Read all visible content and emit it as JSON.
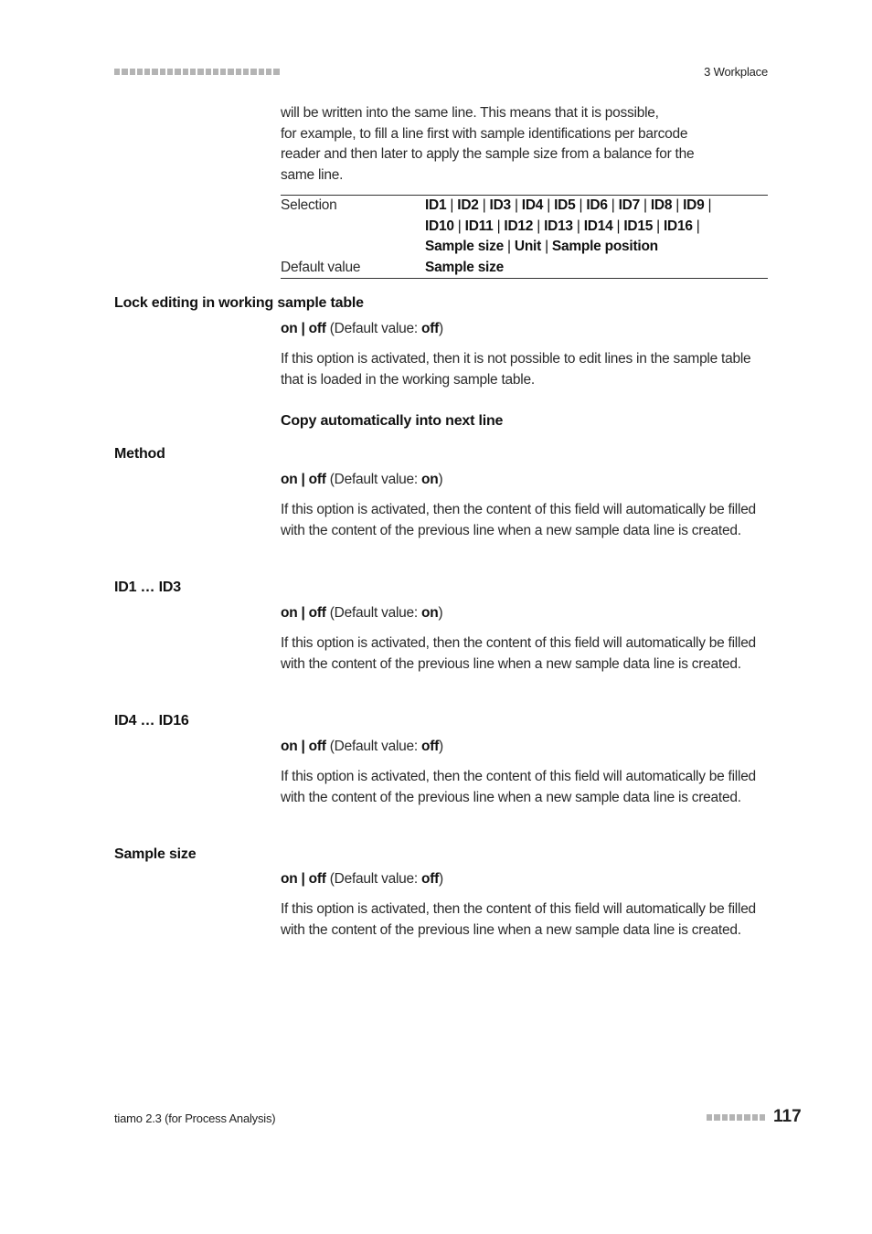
{
  "header": {
    "chapter": "3 Workplace",
    "decor_squares": 22
  },
  "intro": {
    "lines": [
      "will be written into the same line. This means that it is possible,",
      "for example, to fill a line first with sample identifications per barcode",
      "reader and then later to apply the sample size from a balance for the",
      "same line."
    ]
  },
  "table": {
    "selection_label": "Selection",
    "selection_lines": [
      [
        "ID1",
        "ID2",
        "ID3",
        "ID4",
        "ID5",
        "ID6",
        "ID7",
        "ID8",
        "ID9",
        ""
      ],
      [
        "ID10",
        "ID11",
        "ID12",
        "ID13",
        "ID14",
        "ID15",
        "ID16",
        ""
      ],
      [
        "Sample size",
        "Unit",
        "Sample position"
      ]
    ],
    "default_label": "Default value",
    "default_value": "Sample size"
  },
  "params": [
    {
      "title": "Lock editing in working sample table",
      "on": "on",
      "sep": " | ",
      "off": "off",
      "default_prefix": " (Default value: ",
      "default": "off",
      "default_suffix": ")",
      "description": "If this option is activated, then it is not possible to edit lines in the sample table that is loaded in the working sample table."
    },
    {
      "title": "Method",
      "on": "on",
      "sep": " | ",
      "off": "off",
      "default_prefix": " (Default value: ",
      "default": "on",
      "default_suffix": ")",
      "description": "If this option is activated, then the content of this field will automatically be filled with the content of the previous line when a new sample data line is created."
    },
    {
      "title": "ID1 … ID3",
      "on": "on",
      "sep": " | ",
      "off": "off",
      "default_prefix": " (Default value: ",
      "default": "on",
      "default_suffix": ")",
      "description": "If this option is activated, then the content of this field will automatically be filled with the content of the previous line when a new sample data line is created."
    },
    {
      "title": "ID4 … ID16",
      "on": "on",
      "sep": " | ",
      "off": "off",
      "default_prefix": " (Default value: ",
      "default": "off",
      "default_suffix": ")",
      "description": "If this option is activated, then the content of this field will automatically be filled with the content of the previous line when a new sample data line is created."
    },
    {
      "title": "Sample size",
      "on": "on",
      "sep": " | ",
      "off": "off",
      "default_prefix": " (Default value: ",
      "default": "off",
      "default_suffix": ")",
      "description": "If this option is activated, then the content of this field will automatically be filled with the content of the previous line when a new sample data line is created."
    }
  ],
  "subsection": {
    "title": "Copy automatically into next line"
  },
  "footer": {
    "product": "tiamo 2.3 (for Process Analysis)",
    "page_number": "117",
    "decor_squares": 8
  }
}
